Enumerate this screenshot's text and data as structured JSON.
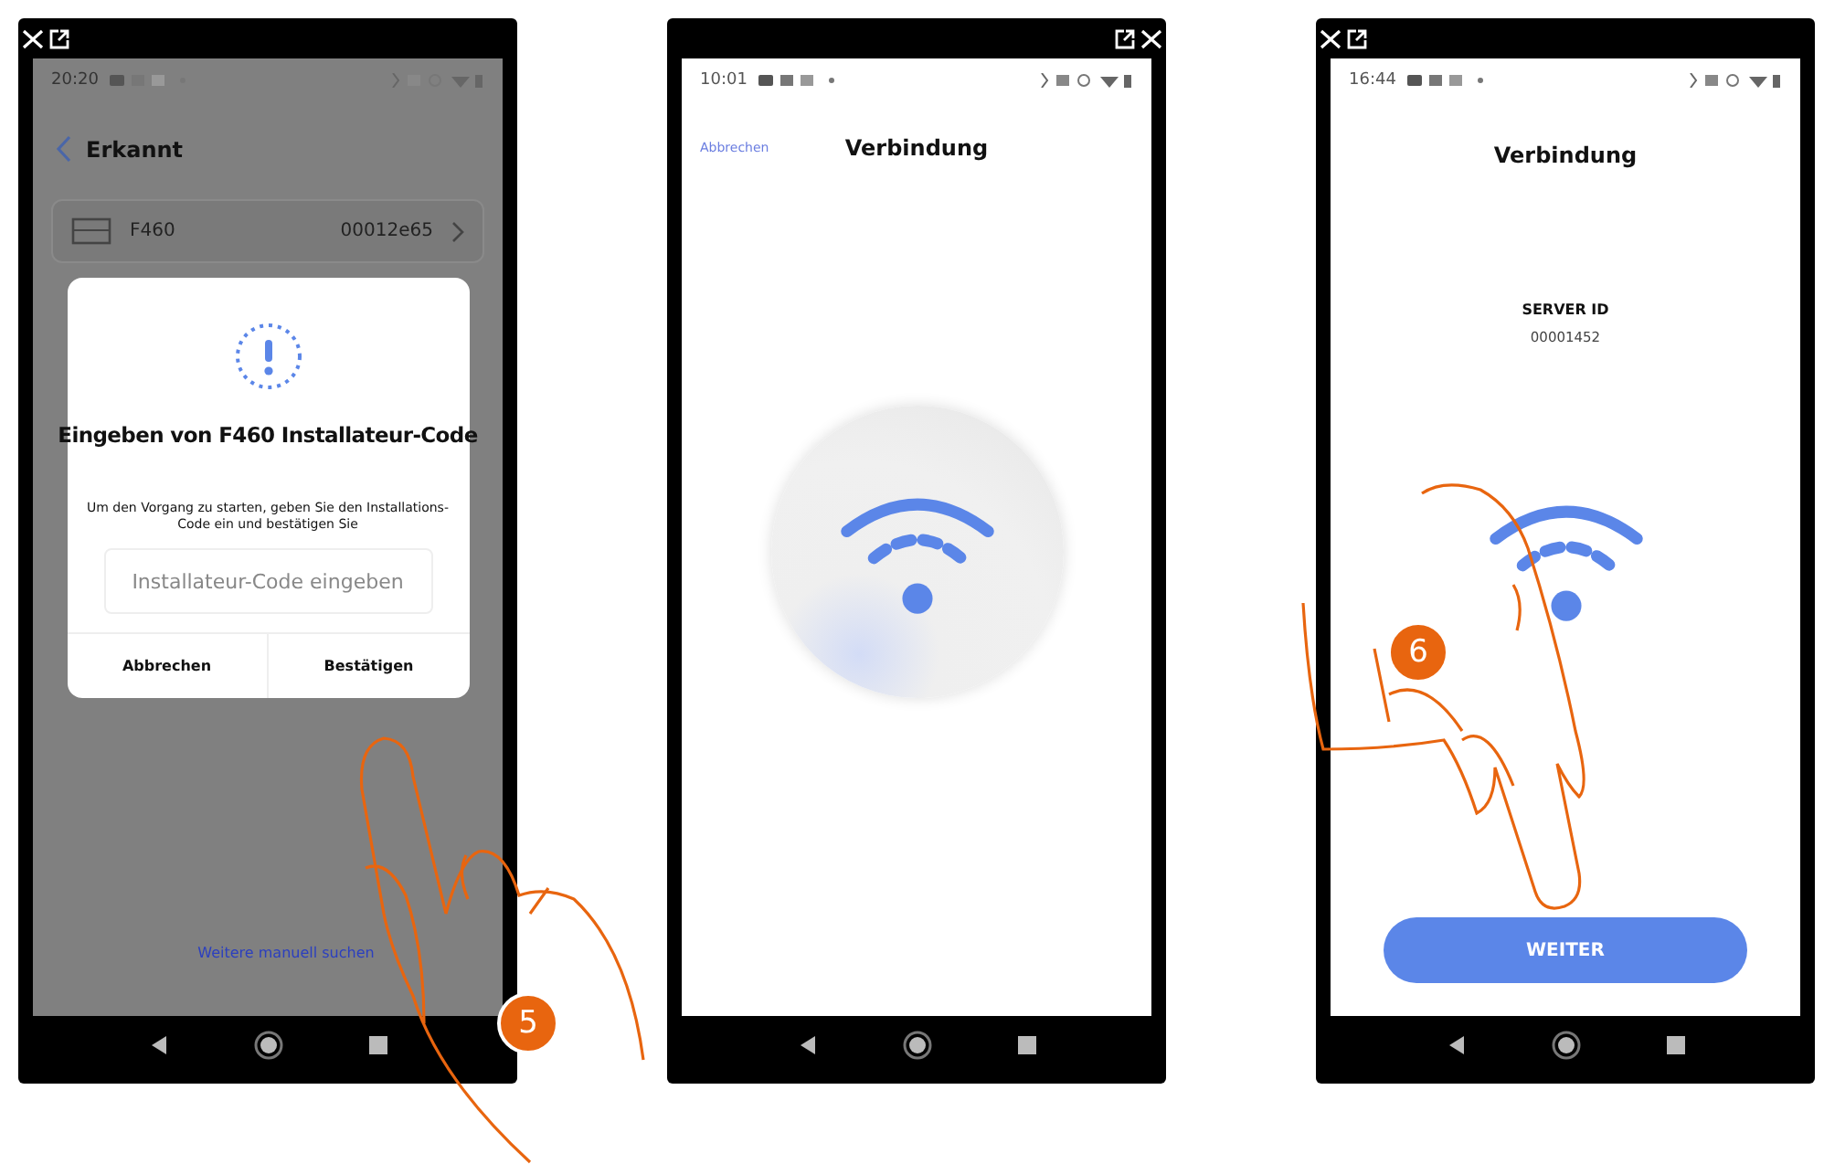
{
  "phones": [
    {
      "kind": "dialog",
      "time": "20:20",
      "title": "Erkannt",
      "device": {
        "name": "F460",
        "code": "00012e65"
      },
      "dialog": {
        "title": "Eingeben von F460 Installateur-Code",
        "text": "Um den Vorgang zu starten, geben Sie den Installations-Code ein und bestätigen Sie",
        "placeholder": "Installateur-Code eingeben",
        "buttons": [
          "Abbrechen",
          "Bestätigen"
        ]
      },
      "link": "Weitere manuell suchen",
      "step": "5"
    },
    {
      "kind": "connecting",
      "time": "10:01",
      "cancel": "Abbrechen",
      "title": "Verbindung"
    },
    {
      "kind": "server",
      "time": "16:44",
      "title": "Verbindung",
      "server_label": "SERVER ID",
      "server_id": "00001452",
      "button": "WEITER",
      "step": "6"
    }
  ]
}
